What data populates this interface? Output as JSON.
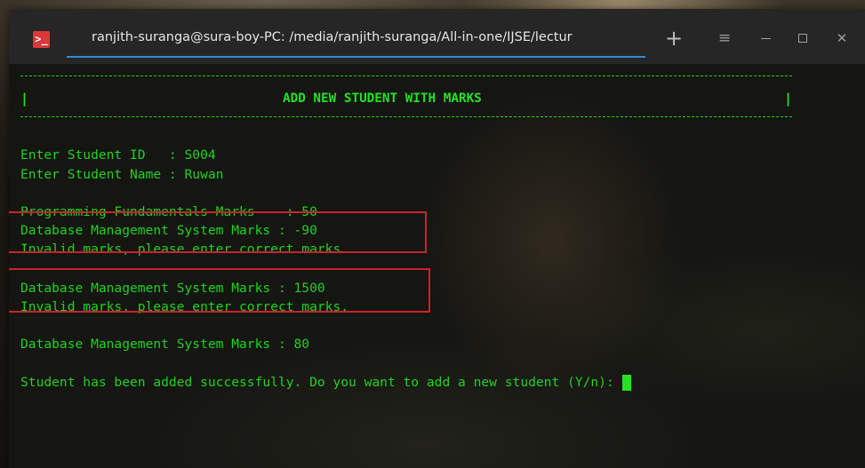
{
  "window": {
    "tab_title": "ranjith-suranga@sura-boy-PC: /media/ranjith-suranga/All-in-one/IJSE/lectur",
    "app_icon_glyph": ">_",
    "controls": {
      "new_tab": "+",
      "menu": "≡",
      "close": "✕"
    },
    "accent_color": "#2f8cde",
    "icon_color": "#d9393b"
  },
  "terminal": {
    "text_color": "#1ed31e",
    "header": {
      "title": "ADD NEW STUDENT WITH MARKS",
      "left_bar": "|",
      "right_bar": "|"
    },
    "lines": {
      "student_id": "Enter Student ID   : S004",
      "student_name": "Enter Student Name : Ruwan",
      "pf_marks": "Programming Fundamentals Marks    : 50",
      "dbms_marks_1": "Database Management System Marks : -90",
      "invalid_1": "Invalid marks, please enter correct marks.",
      "dbms_marks_2": "Database Management System Marks : 1500",
      "invalid_2": "Invalid marks, please enter correct marks.",
      "dbms_marks_3": "Database Management System Marks : 80",
      "success_prompt": "Student has been added successfully. Do you want to add a new student (Y/n): "
    },
    "annotation_color": "#c8232b"
  }
}
